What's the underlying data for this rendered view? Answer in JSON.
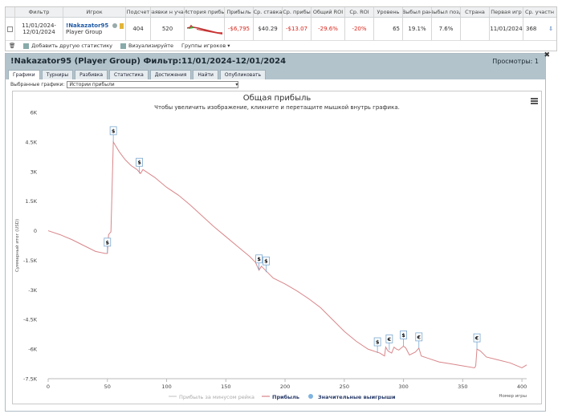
{
  "stats_table": {
    "headers": [
      "Фильтр",
      "Игрок",
      "Подсчет",
      "Заявки н учас",
      "История прибы",
      "Прибыль",
      "Ср. ставка",
      "Ср. прибы",
      "Общий ROI",
      "Ср. ROI",
      "Уровень",
      "Выбыл ран",
      "Выбыл позд",
      "Страна",
      "Первая игр",
      "Ср. участн"
    ],
    "row": {
      "filter_line1": "11/01/2024-",
      "filter_line2": "12/01/2024",
      "player_name": "!Nakazator95",
      "player_group": "Player Group",
      "count": "404",
      "entries": "520",
      "profit": "-$6,795",
      "avg_stake": "$40.29",
      "avg_profit": "-$13.07",
      "total_roi": "-29.6%",
      "avg_roi": "-20%",
      "level": "65",
      "early_out": "19.1%",
      "late_out": "7.6%",
      "country": "",
      "first_game": "11/01/2024",
      "avg_field": "368"
    }
  },
  "toolbar": {
    "add_stat": "Добавить другую статистику",
    "visualize": "Визуализируйте",
    "groups": "Группы игроков"
  },
  "panel": {
    "title": "!Nakazator95 (Player Group) Фильтр:11/01/2024-12/01/2024",
    "views": "Просмотры: 1",
    "tabs": [
      "Графики",
      "Турниры",
      "Разбивка",
      "Статистика",
      "Достижения",
      "Найти",
      "Опубликовать"
    ],
    "select_label": "Выбранные графики:",
    "select_value": "Истории прибыли"
  },
  "chart_data": {
    "type": "line",
    "title": "Общая прибыль",
    "subtitle": "Чтобы увеличить изображение, кликните и перетащите мышкой внутрь графика.",
    "xlabel": "Номер игры",
    "ylabel": "Суммарный итог (USD)",
    "xlim": [
      0,
      404
    ],
    "ylim": [
      -7500,
      6000
    ],
    "x_ticks": [
      0,
      50,
      100,
      150,
      200,
      250,
      300,
      350,
      400
    ],
    "y_ticks": [
      6000,
      4500,
      3000,
      1500,
      0,
      -1500,
      -3000,
      -4500,
      -6000,
      -7500
    ],
    "y_tick_labels": [
      "6K",
      "4.5K",
      "3K",
      "1.5K",
      "0",
      "-1.5K",
      "-3K",
      "-4.5K",
      "-6K",
      "-7.5K"
    ],
    "series": [
      {
        "name": "Прибыль",
        "color": "#d9868a",
        "x": [
          0,
          10,
          20,
          30,
          40,
          48,
          50,
          51,
          53,
          55,
          56,
          60,
          65,
          70,
          75,
          78,
          80,
          90,
          100,
          110,
          120,
          130,
          140,
          150,
          160,
          170,
          175,
          178,
          180,
          185,
          190,
          200,
          210,
          220,
          230,
          240,
          250,
          260,
          270,
          280,
          284,
          285,
          287,
          290,
          292,
          294,
          296,
          300,
          302,
          305,
          310,
          313,
          315,
          320,
          330,
          340,
          350,
          360,
          361,
          362,
          365,
          370,
          380,
          390,
          400,
          404
        ],
        "y": [
          0,
          -200,
          -450,
          -750,
          -1050,
          -1150,
          -1150,
          -200,
          -50,
          4500,
          4400,
          4000,
          3600,
          3300,
          3100,
          2900,
          3100,
          2700,
          2200,
          1800,
          1300,
          750,
          200,
          -300,
          -800,
          -1300,
          -1600,
          -2000,
          -1800,
          -2100,
          -2400,
          -2700,
          -3050,
          -3450,
          -3900,
          -4500,
          -5100,
          -5600,
          -6000,
          -6200,
          -6350,
          -5900,
          -6100,
          -6200,
          -5900,
          -6000,
          -6050,
          -5850,
          -5950,
          -6300,
          -6150,
          -5950,
          -6350,
          -6450,
          -6650,
          -6750,
          -6850,
          -6950,
          -6850,
          -6000,
          -6100,
          -6400,
          -6550,
          -6700,
          -6950,
          -6800
        ]
      }
    ],
    "legend": [
      "Прибыль за минусом рейка",
      "Прибыль",
      "Значительные выигрыши"
    ],
    "legend_placement": "bottom-center",
    "big_win_markers": [
      {
        "x": 50,
        "y": -1150,
        "label": "$"
      },
      {
        "x": 55,
        "y": 4500,
        "label": "$"
      },
      {
        "x": 77,
        "y": 2900,
        "label": "$"
      },
      {
        "x": 178,
        "y": -2000,
        "label": "$"
      },
      {
        "x": 184,
        "y": -2100,
        "label": "$"
      },
      {
        "x": 278,
        "y": -6200,
        "label": "$"
      },
      {
        "x": 288,
        "y": -6050,
        "label": "€"
      },
      {
        "x": 300,
        "y": -5850,
        "label": "$"
      },
      {
        "x": 313,
        "y": -5950,
        "label": "€"
      },
      {
        "x": 362,
        "y": -6000,
        "label": "€"
      }
    ],
    "grid": "x-vertical-none"
  }
}
